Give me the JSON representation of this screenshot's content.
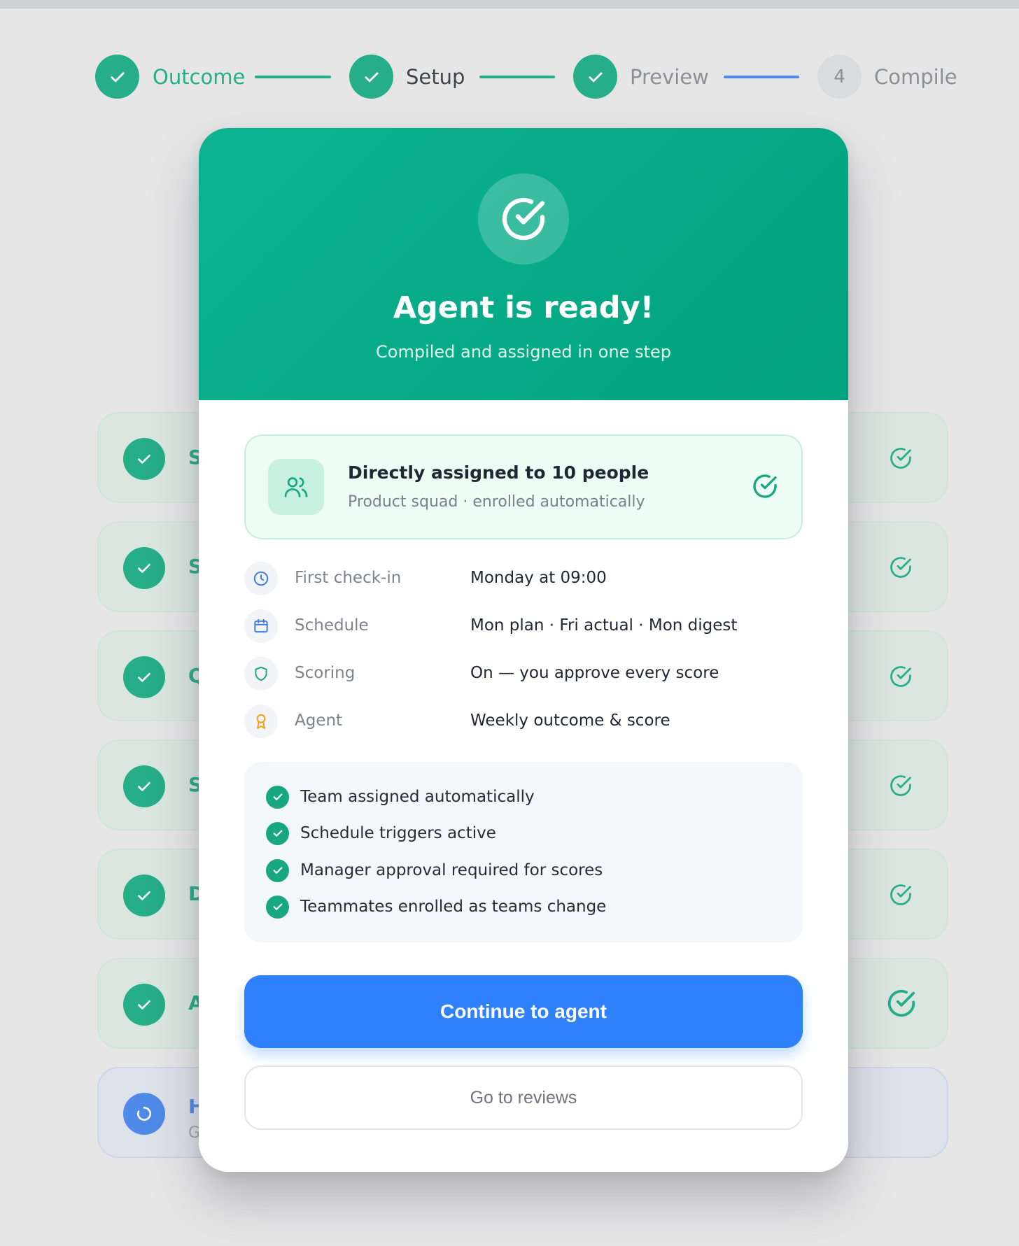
{
  "steps": [
    {
      "label": "Outcome",
      "state": "done",
      "number": ""
    },
    {
      "label": "Setup",
      "state": "done",
      "number": ""
    },
    {
      "label": "Preview",
      "state": "done",
      "number": ""
    },
    {
      "label": "Compile",
      "state": "todo",
      "number": "4"
    }
  ],
  "background_list": {
    "letters": [
      "S",
      "S",
      "Q",
      "S",
      "D",
      "A"
    ],
    "pending_letter": "H",
    "pending_sub": "G"
  },
  "modal": {
    "title": "Agent is ready!",
    "subtitle": "Compiled and assigned in one step",
    "assignment": {
      "title": "Directly assigned to 10 people",
      "subtitle": "Product squad · enrolled automatically"
    },
    "details": [
      {
        "icon": "clock-icon",
        "label": "First check-in",
        "value": "Monday at 09:00"
      },
      {
        "icon": "calendar-icon",
        "label": "Schedule",
        "value": "Mon plan · Fri actual · Mon digest"
      },
      {
        "icon": "shield-icon",
        "label": "Scoring",
        "value": "On — you approve every score"
      },
      {
        "icon": "award-icon",
        "label": "Agent",
        "value": "Weekly outcome & score"
      }
    ],
    "checklist": [
      "Team assigned automatically",
      "Schedule triggers active",
      "Manager approval required for scores",
      "Teammates enrolled as teams change"
    ],
    "primary_button": "Continue to agent",
    "secondary_button": "Go to reviews"
  },
  "colors": {
    "accent_green": "#26ad89",
    "primary_blue": "#2f80fb",
    "pending_blue": "#4f8ae8"
  }
}
